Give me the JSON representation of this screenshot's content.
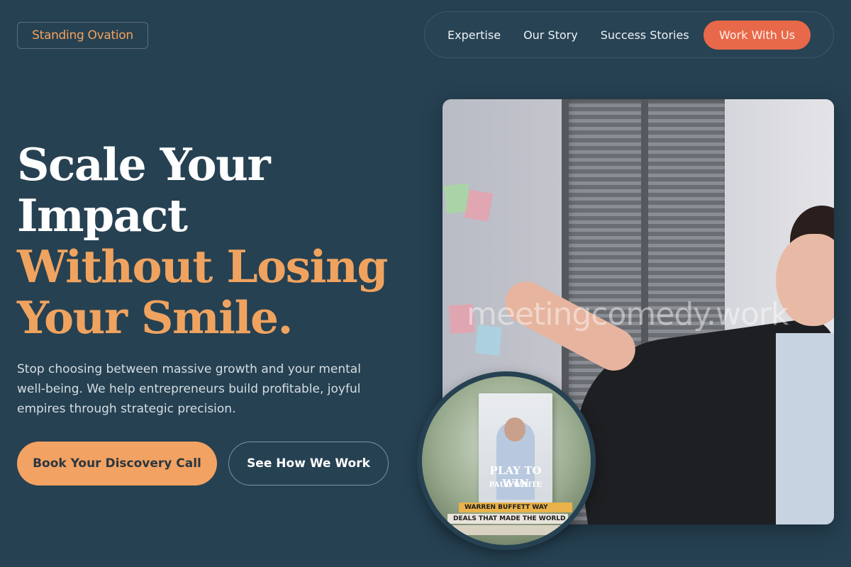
{
  "brand": {
    "logo_text": "Standing Ovation"
  },
  "nav": {
    "links": [
      "Expertise",
      "Our Story",
      "Success Stories"
    ],
    "cta": "Work With Us"
  },
  "hero": {
    "headline_line1": "Scale Your",
    "headline_line2": "Impact",
    "headline_line3": "Without Losing",
    "headline_line4": "Your Smile.",
    "subtext": "Stop choosing between massive growth and your mental well-being. We help entrepreneurs build profitable, joyful empires through strategic precision.",
    "primary_button": "Book Your Discovery Call",
    "secondary_button": "See How We Work"
  },
  "image": {
    "watermark": "meetingcomedy.work",
    "book_title": "PLAY TO WIN",
    "book_author": "PAUL WHITE",
    "stack_titles": [
      "WARREN BUFFETT WAY",
      "DEALS THAT MADE THE WORLD"
    ]
  },
  "colors": {
    "background": "#264152",
    "accent_orange": "#f0a35f",
    "cta_coral": "#e8694a"
  }
}
